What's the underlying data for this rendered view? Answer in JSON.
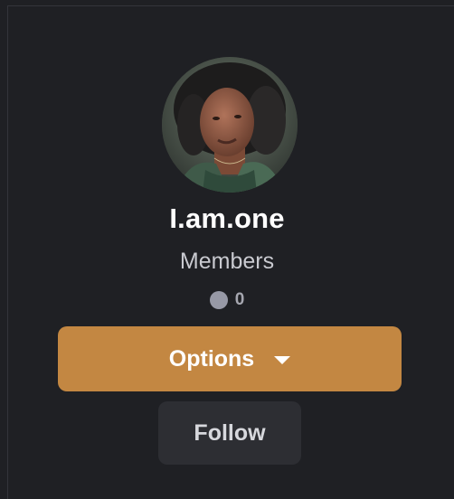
{
  "profile": {
    "display_name": "I.am.one",
    "role": "Members",
    "reputation_icon": "circle-dot-icon",
    "reputation_count": "0"
  },
  "actions": {
    "options_label": "Options",
    "options_icon": "caret-down-icon",
    "follow_label": "Follow"
  },
  "colors": {
    "background": "#1f2024",
    "accent": "#c38742",
    "secondary_button": "#2d2e33",
    "text_primary": "#ffffff",
    "text_secondary": "#c9cad0"
  }
}
